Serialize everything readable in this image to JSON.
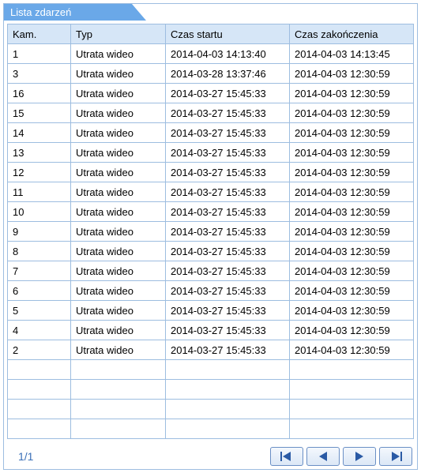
{
  "panel_title": "Lista zdarzeń",
  "columns": {
    "kam": "Kam.",
    "typ": "Typ",
    "start": "Czas startu",
    "end": "Czas zakończenia"
  },
  "rows": [
    {
      "kam": "1",
      "typ": "Utrata wideo",
      "start": "2014-04-03 14:13:40",
      "end": "2014-04-03 14:13:45"
    },
    {
      "kam": "3",
      "typ": "Utrata wideo",
      "start": "2014-03-28 13:37:46",
      "end": "2014-04-03 12:30:59"
    },
    {
      "kam": "16",
      "typ": "Utrata wideo",
      "start": "2014-03-27 15:45:33",
      "end": "2014-04-03 12:30:59"
    },
    {
      "kam": "15",
      "typ": "Utrata wideo",
      "start": "2014-03-27 15:45:33",
      "end": "2014-04-03 12:30:59"
    },
    {
      "kam": "14",
      "typ": "Utrata wideo",
      "start": "2014-03-27 15:45:33",
      "end": "2014-04-03 12:30:59"
    },
    {
      "kam": "13",
      "typ": "Utrata wideo",
      "start": "2014-03-27 15:45:33",
      "end": "2014-04-03 12:30:59"
    },
    {
      "kam": "12",
      "typ": "Utrata wideo",
      "start": "2014-03-27 15:45:33",
      "end": "2014-04-03 12:30:59"
    },
    {
      "kam": "11",
      "typ": "Utrata wideo",
      "start": "2014-03-27 15:45:33",
      "end": "2014-04-03 12:30:59"
    },
    {
      "kam": "10",
      "typ": "Utrata wideo",
      "start": "2014-03-27 15:45:33",
      "end": "2014-04-03 12:30:59"
    },
    {
      "kam": "9",
      "typ": "Utrata wideo",
      "start": "2014-03-27 15:45:33",
      "end": "2014-04-03 12:30:59"
    },
    {
      "kam": "8",
      "typ": "Utrata wideo",
      "start": "2014-03-27 15:45:33",
      "end": "2014-04-03 12:30:59"
    },
    {
      "kam": "7",
      "typ": "Utrata wideo",
      "start": "2014-03-27 15:45:33",
      "end": "2014-04-03 12:30:59"
    },
    {
      "kam": "6",
      "typ": "Utrata wideo",
      "start": "2014-03-27 15:45:33",
      "end": "2014-04-03 12:30:59"
    },
    {
      "kam": "5",
      "typ": "Utrata wideo",
      "start": "2014-03-27 15:45:33",
      "end": "2014-04-03 12:30:59"
    },
    {
      "kam": "4",
      "typ": "Utrata wideo",
      "start": "2014-03-27 15:45:33",
      "end": "2014-04-03 12:30:59"
    },
    {
      "kam": "2",
      "typ": "Utrata wideo",
      "start": "2014-03-27 15:45:33",
      "end": "2014-04-03 12:30:59"
    }
  ],
  "empty_rows": 4,
  "page_indicator": "1/1",
  "nav": {
    "first": "first",
    "prev": "prev",
    "next": "next",
    "last": "last"
  }
}
